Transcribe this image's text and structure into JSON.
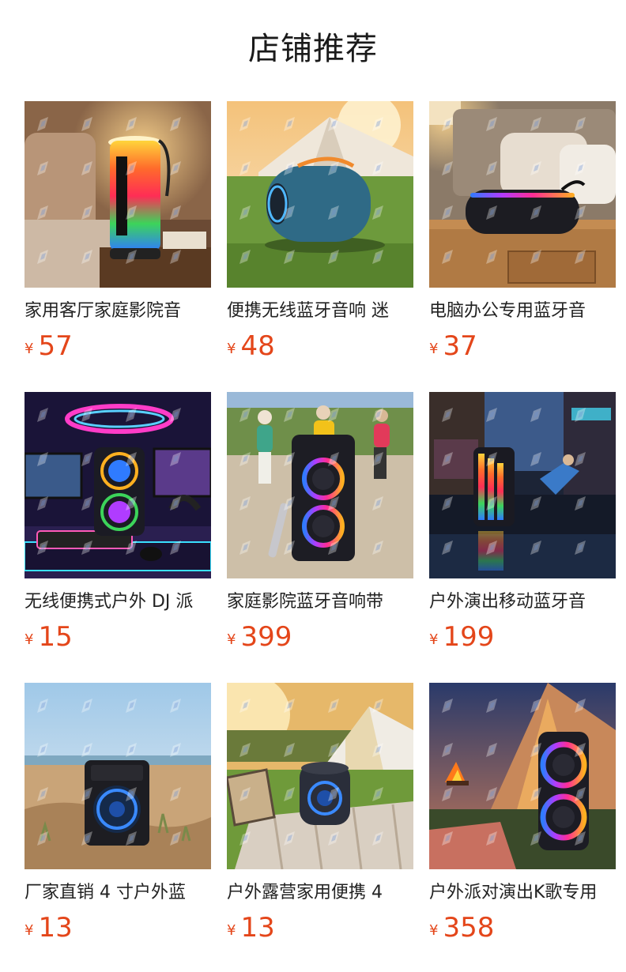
{
  "page": {
    "title": "店铺推荐",
    "accent_color": "#e4461a"
  },
  "products": [
    {
      "name": "家用客厅家庭影院音",
      "currency": "¥",
      "price": "57",
      "image": "rgb-lantern-speaker-bedside"
    },
    {
      "name": "便携无线蓝牙音响 迷",
      "currency": "¥",
      "price": "48",
      "image": "blue-portable-speaker-on-grass"
    },
    {
      "name": "电脑办公专用蓝牙音",
      "currency": "¥",
      "price": "37",
      "image": "rgb-bar-speaker-nightstand"
    },
    {
      "name": "无线便携式户外 DJ 派",
      "currency": "¥",
      "price": "15",
      "image": "gaming-setup-rgb-speaker"
    },
    {
      "name": "家庭影院蓝牙音响带",
      "currency": "¥",
      "price": "399",
      "image": "square-dance-party-speaker-with-mic"
    },
    {
      "name": "户外演出移动蓝牙音",
      "currency": "¥",
      "price": "199",
      "image": "street-dance-led-speaker-night"
    },
    {
      "name": "厂家直销 4 寸户外蓝",
      "currency": "¥",
      "price": "13",
      "image": "small-speaker-on-beach-dune"
    },
    {
      "name": "户外露营家用便携 4",
      "currency": "¥",
      "price": "13",
      "image": "camping-speaker-picnic-blanket"
    },
    {
      "name": "户外派对演出K歌专用",
      "currency": "¥",
      "price": "358",
      "image": "tent-campfire-rgb-tower-speaker"
    }
  ]
}
